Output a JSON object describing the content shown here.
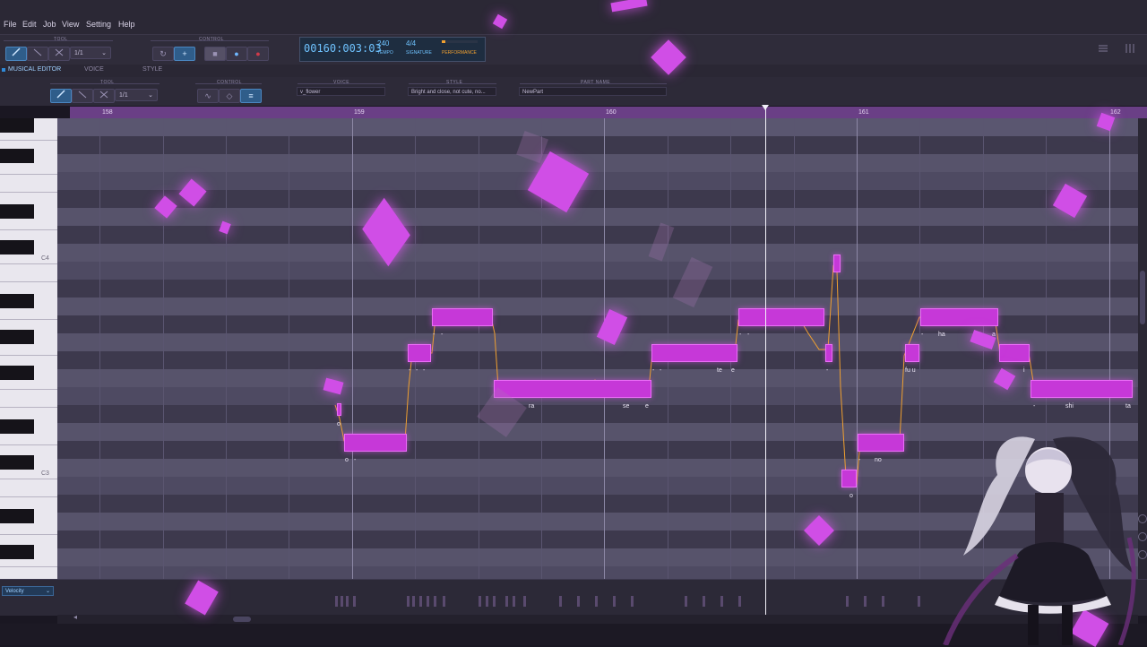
{
  "menu": [
    "File",
    "Edit",
    "Job",
    "View",
    "Setting",
    "Help"
  ],
  "toolbar": {
    "tool_label": "TOOL",
    "control_label": "CONTROL",
    "quantize": "1/1",
    "transport": {
      "position": "00160:003:03",
      "tempo_value": "240",
      "tempo_label": "TEMPO",
      "signature_value": "4/4",
      "signature_label": "SIGNATURE",
      "performance_label": "PERFORMANCE"
    }
  },
  "tabs": [
    "MUSICAL EDITOR",
    "VOICE",
    "STYLE"
  ],
  "editor": {
    "tool_label": "TOOL",
    "quantize": "1/1",
    "control_label": "CONTROL",
    "voice_label": "VOICE",
    "voice_value": "v_flower",
    "style_label": "STYLE",
    "style_value": "Bright and close, not cute, no...",
    "partname_label": "PART NAME",
    "partname_value": "NewPart"
  },
  "ruler": {
    "bars": [
      "158",
      "159",
      "160",
      "161",
      "162"
    ]
  },
  "keyboard": {
    "labels": [
      "C4",
      "C3"
    ]
  },
  "lyrics": [
    "o",
    "o",
    "-",
    "-",
    "-",
    "-",
    "-",
    "-",
    "ra",
    "se",
    "e",
    "-",
    "-",
    "te",
    "e",
    "-",
    "-",
    "-",
    "o",
    "-",
    "no",
    "fu u",
    "-",
    "ha",
    "a",
    "i",
    "-",
    "shi",
    "ta"
  ],
  "velocity_lane": {
    "selector": "Velocity"
  },
  "colors": {
    "note": "#c638d8",
    "ruler": "#6a3f86",
    "transport_text": "#6fc3ff",
    "accent": "#2f8ad8"
  },
  "icons": [
    "pencil-icon",
    "line-icon",
    "scissors-icon",
    "loop-icon",
    "metronome-icon",
    "stop-icon",
    "play-icon",
    "record-icon",
    "list-icon",
    "mixer-icon"
  ]
}
